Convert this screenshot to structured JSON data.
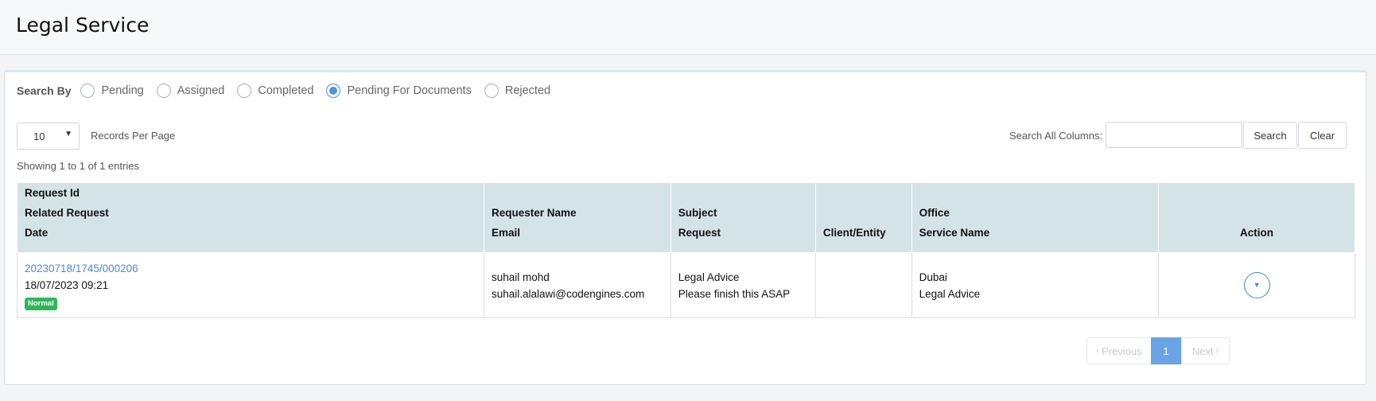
{
  "page": {
    "title": "Legal Service"
  },
  "filters": {
    "label": "Search By",
    "options": [
      {
        "label": "Pending",
        "checked": false
      },
      {
        "label": "Assigned",
        "checked": false
      },
      {
        "label": "Completed",
        "checked": false
      },
      {
        "label": "Pending For Documents",
        "checked": true
      },
      {
        "label": "Rejected",
        "checked": false
      }
    ]
  },
  "controls": {
    "records_per_page_value": "10",
    "records_per_page_label": "Records Per Page",
    "search_all_label": "Search All Columns:",
    "search_value": "",
    "search_button": "Search",
    "clear_button": "Clear"
  },
  "summary": {
    "showing": "Showing 1 to 1 of 1 entries"
  },
  "table": {
    "headers": {
      "col1": [
        "Request Id",
        "Related Request",
        "Date"
      ],
      "col2": [
        "Requester Name",
        "Email"
      ],
      "col3": [
        "Subject",
        "Request"
      ],
      "col4": [
        "Client/Entity"
      ],
      "col5": [
        "Office",
        "Service Name"
      ],
      "col6": [
        "Action"
      ]
    },
    "rows": [
      {
        "request_id": "20230718/1745/000206",
        "date": "18/07/2023 09:21",
        "priority": "Normal",
        "requester_name": "suhail mohd",
        "email": "suhail.alalawi@codengines.com",
        "subject": "Legal Advice",
        "request": "Please finish this ASAP",
        "client_entity": "",
        "office": "Dubai",
        "service_name": "Legal Advice"
      }
    ]
  },
  "pagination": {
    "previous": "Previous",
    "current_page": "1",
    "next": "Next"
  },
  "colors": {
    "accent": "#4f92e0",
    "header_bg": "#d4e3e6",
    "badge": "#2db858"
  }
}
